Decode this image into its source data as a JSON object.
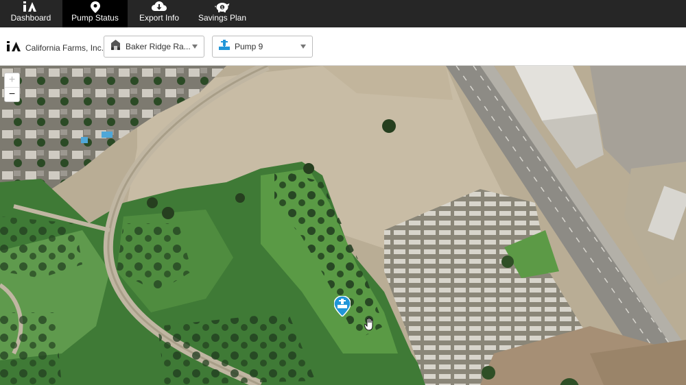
{
  "nav": {
    "items": [
      {
        "label": "Dashboard",
        "icon": "logo-icon"
      },
      {
        "label": "Pump Status",
        "icon": "map-pin-icon"
      },
      {
        "label": "Export Info",
        "icon": "cloud-download-icon"
      },
      {
        "label": "Savings Plan",
        "icon": "piggy-bank-icon"
      }
    ],
    "active": "Pump Status"
  },
  "toolbar": {
    "org_name": "California Farms, Inc.",
    "ranch_select": "Baker Ridge Ra...",
    "pump_select": "Pump 9"
  },
  "map": {
    "zoom_in": "+",
    "zoom_out": "−",
    "marker_icon": "pump-location-pin-icon"
  },
  "colors": {
    "nav_bg": "#262626",
    "nav_active": "#000000",
    "accent_blue": "#2196d8"
  }
}
